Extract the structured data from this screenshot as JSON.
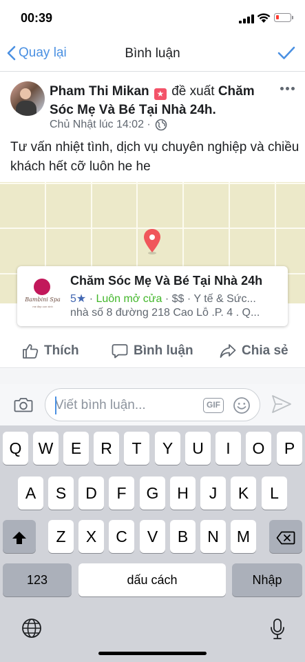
{
  "status_bar": {
    "time": "00:39",
    "battery_color": "#ff3b30"
  },
  "nav": {
    "back_label": "Quay lại",
    "title": "Bình luận",
    "accent": "#4a90e2"
  },
  "post": {
    "author": "Pham Thi Mikan",
    "verb": "đề xuất",
    "page": "Chăm Sóc Mẹ Và Bé Tại Nhà 24h.",
    "time": "Chủ Nhật lúc 14:02 ·",
    "text": "Tư vấn nhiệt tình, dịch vụ chuyên nghiệp và chiều khách hết cỡ luôn he he"
  },
  "place": {
    "logo_brand": "Bambini Spa",
    "logo_sub": "mẹ đẹp con xinh",
    "name": "Chăm Sóc Mẹ Và Bé Tại Nhà 24h",
    "rating": "5★",
    "open_status": "Luôn mở cửa",
    "meta_rest": "· $$ · Y tế & Sức...",
    "address": "nhà số 8 đường 218 Cao Lỗ .P. 4 . Q..."
  },
  "actions": {
    "like": "Thích",
    "comment": "Bình luận",
    "share": "Chia sẻ"
  },
  "composer": {
    "placeholder": "Viết bình luận...",
    "gif": "GIF"
  },
  "keyboard": {
    "row1": [
      "Q",
      "W",
      "E",
      "R",
      "T",
      "Y",
      "U",
      "I",
      "O",
      "P"
    ],
    "row2": [
      "A",
      "S",
      "D",
      "F",
      "G",
      "H",
      "J",
      "K",
      "L"
    ],
    "row3": [
      "Z",
      "X",
      "C",
      "V",
      "B",
      "N",
      "M"
    ],
    "numbers": "123",
    "space": "dấu cách",
    "return": "Nhập"
  }
}
